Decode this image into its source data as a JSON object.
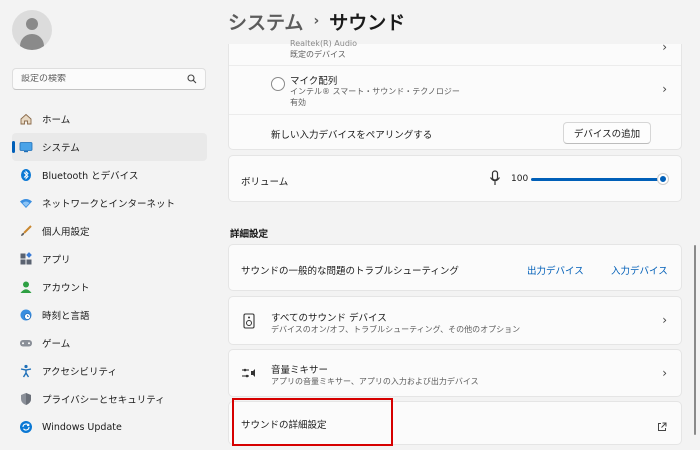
{
  "sidebar": {
    "search_placeholder": "設定の検索",
    "items": [
      {
        "label": "ホーム",
        "icon": "home-icon"
      },
      {
        "label": "システム",
        "icon": "system-icon",
        "active": true
      },
      {
        "label": "Bluetooth とデバイス",
        "icon": "bluetooth-icon"
      },
      {
        "label": "ネットワークとインターネット",
        "icon": "wifi-icon"
      },
      {
        "label": "個人用設定",
        "icon": "brush-icon"
      },
      {
        "label": "アプリ",
        "icon": "apps-icon"
      },
      {
        "label": "アカウント",
        "icon": "account-icon"
      },
      {
        "label": "時刻と言語",
        "icon": "globe-clock-icon"
      },
      {
        "label": "ゲーム",
        "icon": "gamepad-icon"
      },
      {
        "label": "アクセシビリティ",
        "icon": "accessibility-icon"
      },
      {
        "label": "プライバシーとセキュリティ",
        "icon": "shield-icon"
      },
      {
        "label": "Windows Update",
        "icon": "update-icon"
      }
    ]
  },
  "breadcrumb": {
    "parent": "システム",
    "current": "サウンド"
  },
  "input_devices": {
    "partial_device_name": "Realtek(R) Audio",
    "partial_device_sub": "既定のデバイス",
    "mic_name": "マイク配列",
    "mic_vendor": "インテル® スマート・サウンド・テクノロジー",
    "mic_status": "有効",
    "pair_label": "新しい入力デバイスをペアリングする",
    "add_device_button": "デバイスの追加"
  },
  "volume": {
    "label": "ボリューム",
    "value": "100"
  },
  "advanced": {
    "section_title": "詳細設定",
    "troubleshoot_label": "サウンドの一般的な問題のトラブルシューティング",
    "output_link": "出力デバイス",
    "input_link": "入力デバイス",
    "all_devices_title": "すべてのサウンド デバイス",
    "all_devices_sub": "デバイスのオン/オフ、トラブルシューティング、その他のオプション",
    "mixer_title": "音量ミキサー",
    "mixer_sub": "アプリの音量ミキサー、アプリの入力および出力デバイス",
    "more_settings": "サウンドの詳細設定"
  },
  "colors": {
    "accent": "#005fb8",
    "highlight": "#d60000"
  }
}
